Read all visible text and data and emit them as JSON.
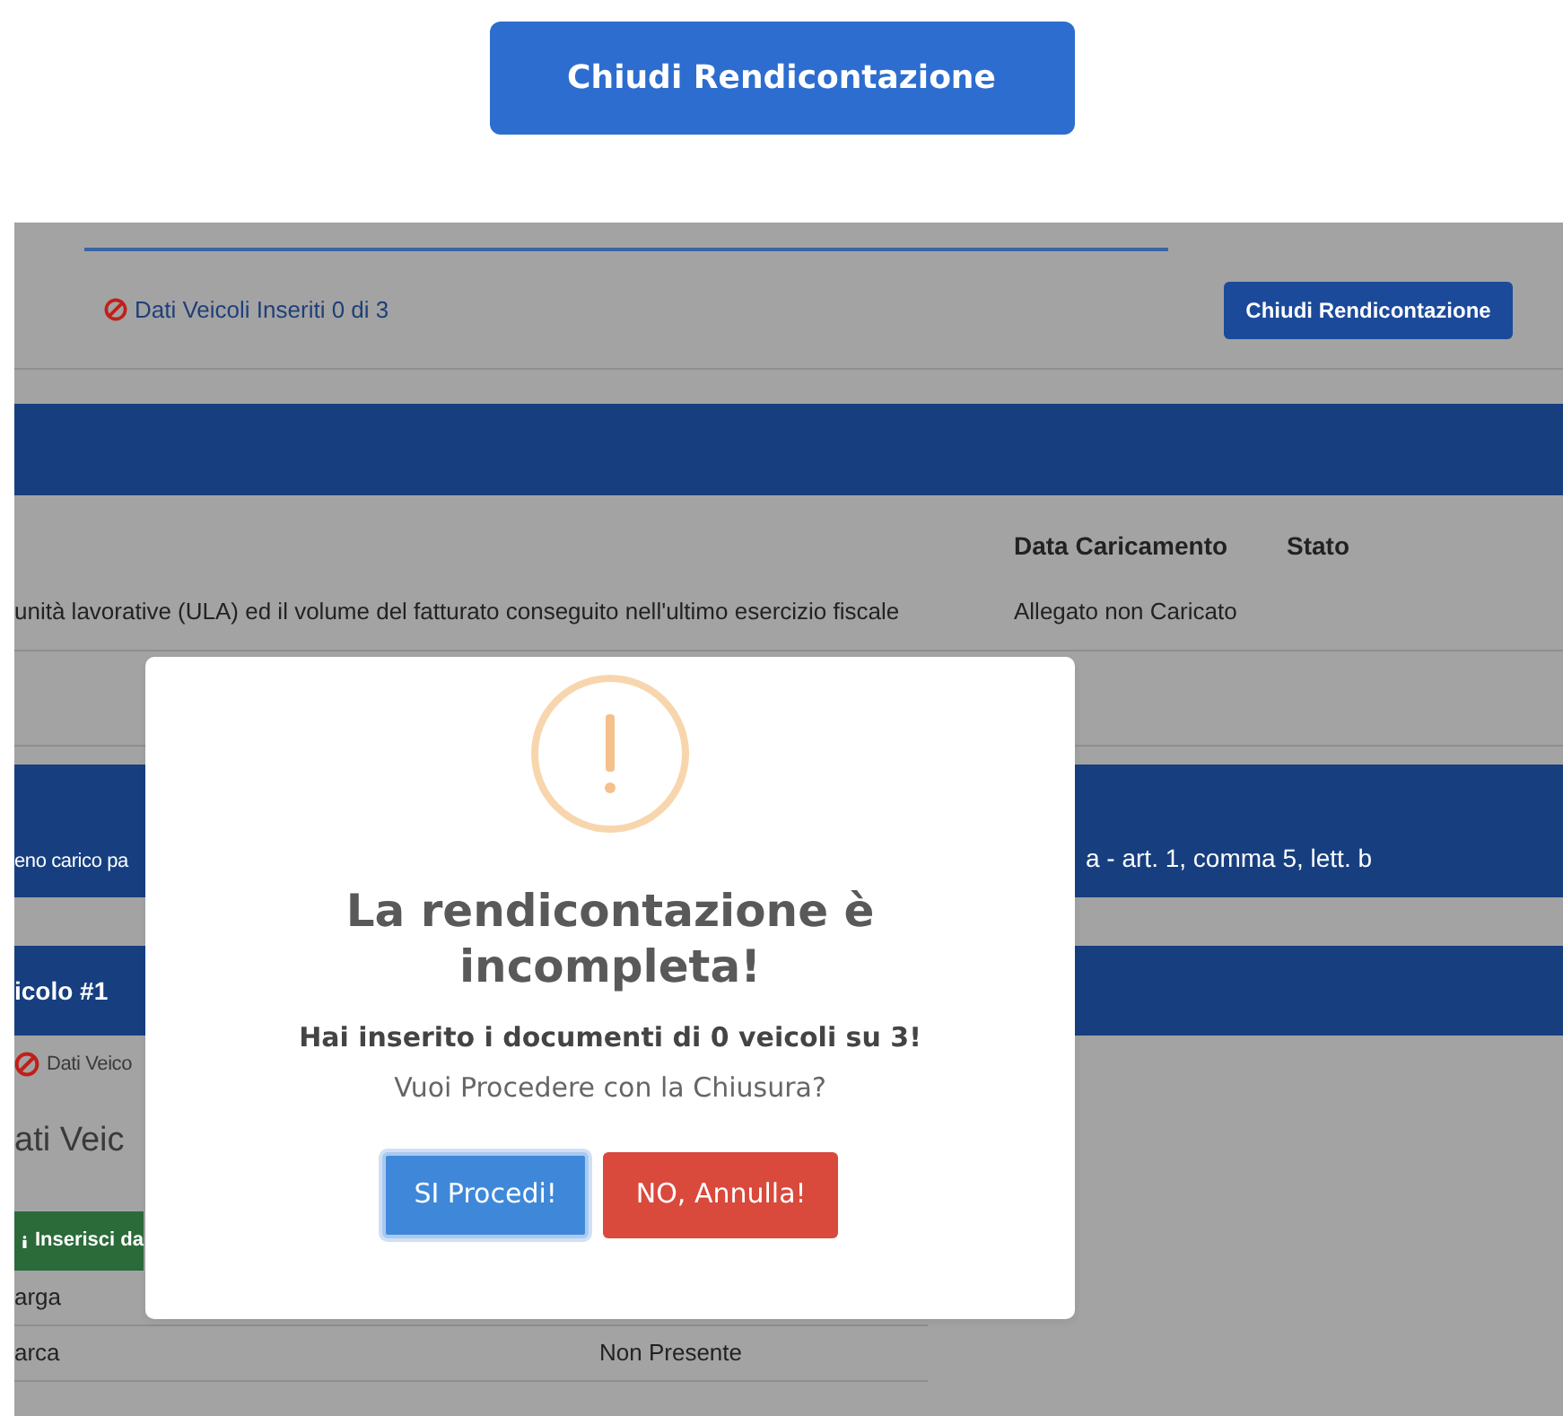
{
  "top_button": {
    "label": "Chiudi Rendicontazione"
  },
  "background_page": {
    "status": {
      "text": "Dati Veicoli Inseriti 0 di 3",
      "complete": false
    },
    "close_button": {
      "label": "Chiudi Rendicontazione"
    },
    "table_headers": [
      "Data Caricamento",
      "Stato"
    ],
    "document_row": {
      "description": "unità lavorative (ULA) ed il volume del fatturato conseguito nell'ultimo esercizio fiscale",
      "upload_date": "Allegato non Caricato"
    },
    "banner": {
      "left_text": "eno carico pa",
      "right_text": "a - art. 1, comma 5, lett. b"
    },
    "vehicle_header": "icolo #1",
    "vehicle_status": {
      "text": "Dati Veico",
      "complete": false
    },
    "section_title": "ati Veic",
    "insert_button": {
      "label": "Inserisci da"
    },
    "fields": [
      {
        "label": "arga"
      },
      {
        "label": "arca",
        "value": "Non Presente"
      }
    ]
  },
  "dialog": {
    "title": "La rendicontazione è incompleta!",
    "message": "Hai inserito i documenti di 0 veicoli su 3!",
    "question": "Vuoi Procedere con la Chiusura?",
    "buttons": [
      {
        "label": "SI Procedi!",
        "kind": "confirm",
        "focused": true
      },
      {
        "label": "NO, Annulla!",
        "kind": "cancel",
        "focused": false
      }
    ]
  }
}
